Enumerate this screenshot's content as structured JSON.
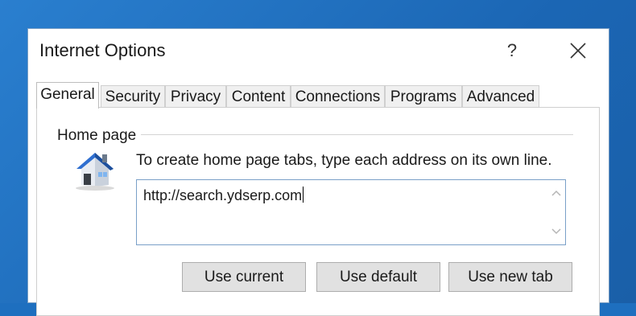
{
  "window": {
    "title": "Internet Options",
    "help_label": "?",
    "close_label": "✕"
  },
  "tabs": [
    {
      "label": "General",
      "active": true
    },
    {
      "label": "Security",
      "active": false
    },
    {
      "label": "Privacy",
      "active": false
    },
    {
      "label": "Content",
      "active": false
    },
    {
      "label": "Connections",
      "active": false
    },
    {
      "label": "Programs",
      "active": false
    },
    {
      "label": "Advanced",
      "active": false
    }
  ],
  "home_page": {
    "group_label": "Home page",
    "icon": "house-icon",
    "instruction": "To create home page tabs, type each address on its own line.",
    "url_value": "http://search.ydserp.com",
    "buttons": {
      "use_current": "Use current",
      "use_default": "Use default",
      "use_new_tab": "Use new tab"
    }
  },
  "colors": {
    "desktop_blue": "#1e6fbf",
    "dialog_bg": "#ffffff",
    "button_bg": "#e1e1e1",
    "input_border": "#7aa0c8"
  }
}
